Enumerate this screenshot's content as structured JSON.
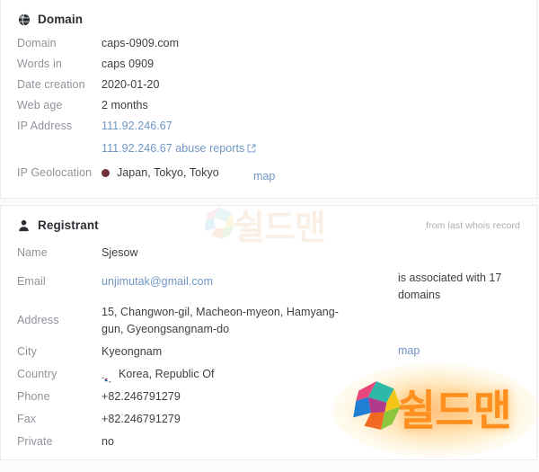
{
  "domain_card": {
    "icon": "globe-icon",
    "title": "Domain",
    "rows": [
      {
        "label": "Domain",
        "value": "caps-0909.com"
      },
      {
        "label": "Words in",
        "value": "caps 0909"
      },
      {
        "label": "Date creation",
        "value": "2020-01-20"
      },
      {
        "label": "Web age",
        "value": "2 months"
      },
      {
        "label": "IP Address",
        "value": "111.92.246.67"
      }
    ],
    "abuse_reports_link": "111.92.246.67 abuse reports",
    "abuse_reports_icon": "external-link-icon",
    "geolocation": {
      "label": "IP Geolocation",
      "flag_icon": "flag-japan-icon",
      "flag_color": "#70303b",
      "value": "Japan, Tokyo, Tokyo",
      "map_link": "map"
    }
  },
  "registrant_card": {
    "icon": "user-icon",
    "title": "Registrant",
    "note": "from last whois record",
    "rows": [
      {
        "label": "Name",
        "value": "Sjesow"
      },
      {
        "label": "Email",
        "value": "unjimutak@gmail.com"
      },
      {
        "label": "Address",
        "value": "15, Changwon-gil, Macheon-myeon, Hamyang-gun, Gyeongsangnam-do"
      },
      {
        "label": "City",
        "value": "Kyeongnam"
      },
      {
        "label": "Country",
        "value": "Korea, Republic Of"
      },
      {
        "label": "Phone",
        "value": "+82.246791279"
      },
      {
        "label": "Fax",
        "value": "+82.246791279"
      },
      {
        "label": "Private",
        "value": "no"
      }
    ],
    "country_flag_icon": "flag-south-korea-icon",
    "city_map_link": "map",
    "associated_text": "is associated with 17 domains"
  },
  "watermark": {
    "logo_icon": "shieldman-s-logo-icon",
    "text": "쉴드맨"
  },
  "colors": {
    "link": "#6f96c4",
    "label": "#8e939b",
    "value": "#3c4043",
    "card_border": "#ececf0",
    "page_bg": "#fbfbfc"
  }
}
